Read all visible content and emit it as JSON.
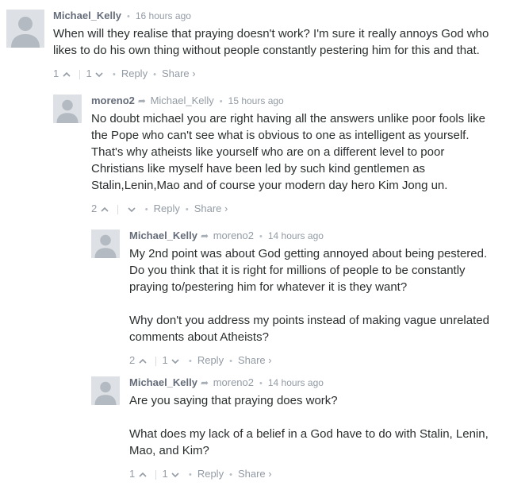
{
  "comments": [
    {
      "author": "Michael_Kelly",
      "parent": "",
      "time": "16 hours ago",
      "paragraphs": [
        "When will they realise that praying doesn't work? I'm sure it really annoys God who likes to do his own thing without people constantly pestering him for this and that."
      ],
      "upvotes": "1",
      "downvotes": "1",
      "reply_label": "Reply",
      "share_label": "Share ›"
    },
    {
      "author": "moreno2",
      "parent": "Michael_Kelly",
      "time": "15 hours ago",
      "paragraphs": [
        "No doubt michael you are right having all the answers unlike poor fools like the Pope who can't see what is obvious to one as intelligent as yourself. That's why atheists like yourself who are on a different level to poor Christians like myself have been led by such kind gentlemen as Stalin,Lenin,Mao and of course your modern day hero Kim Jong un."
      ],
      "upvotes": "2",
      "downvotes": "",
      "reply_label": "Reply",
      "share_label": "Share ›"
    },
    {
      "author": "Michael_Kelly",
      "parent": "moreno2",
      "time": "14 hours ago",
      "paragraphs": [
        "My 2nd point was about God getting annoyed about being pestered. Do you think that it is right for millions of people to be constantly praying to/pestering him for whatever it is they want?",
        "Why don't you address my points instead of making vague unrelated comments about Atheists?"
      ],
      "upvotes": "2",
      "downvotes": "1",
      "reply_label": "Reply",
      "share_label": "Share ›"
    },
    {
      "author": "Michael_Kelly",
      "parent": "moreno2",
      "time": "14 hours ago",
      "paragraphs": [
        "Are you saying that praying does work?",
        "What does my lack of a belief in a God have to do with Stalin, Lenin, Mao, and Kim?"
      ],
      "upvotes": "1",
      "downvotes": "1",
      "reply_label": "Reply",
      "share_label": "Share ›"
    }
  ],
  "separator": "•",
  "reply_arrow": "➦",
  "icons": {
    "avatar": "default-avatar-icon",
    "upvote": "chevron-up-icon",
    "downvote": "chevron-down-icon"
  },
  "colors": {
    "text": "#2a2e2e",
    "author": "#656c7a",
    "meta": "#939ba4",
    "avatar_bg": "#dde1e6",
    "avatar_fg": "#b4bac1"
  }
}
